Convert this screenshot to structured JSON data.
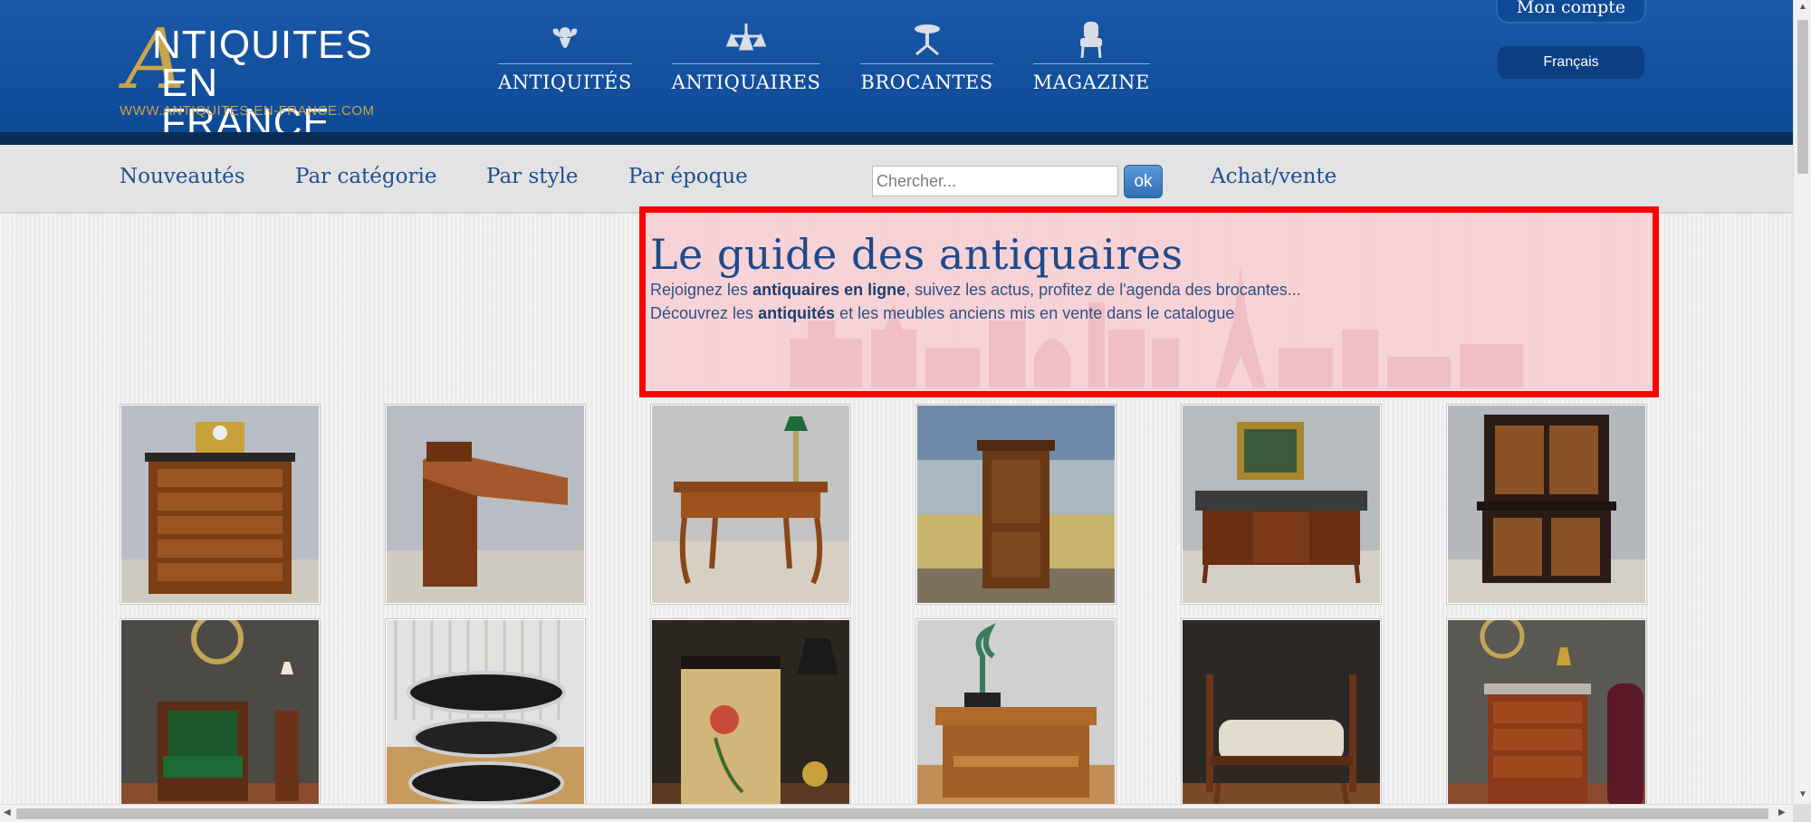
{
  "logo": {
    "line1": "NTIQUITES",
    "line2": "EN FRANCE",
    "initial": "A",
    "url": "WWW.ANTIQUITES-EN-FRANCE.COM"
  },
  "topnav": [
    {
      "label": "ANTIQUITÉS",
      "icon": "cherub-icon"
    },
    {
      "label": "ANTIQUAIRES",
      "icon": "chandelier-icon"
    },
    {
      "label": "BROCANTES",
      "icon": "pedestal-table-icon"
    },
    {
      "label": "MAGAZINE",
      "icon": "armchair-icon"
    }
  ],
  "account": {
    "label": "Mon compte"
  },
  "language": {
    "label": "Français"
  },
  "subnav": {
    "new": "Nouveautés",
    "category": "Par catégorie",
    "style": "Par style",
    "era": "Par époque",
    "buysell": "Achat/vente"
  },
  "search": {
    "placeholder": "Chercher...",
    "button": "ok"
  },
  "hero": {
    "title": "Le guide des antiquaires",
    "line1_pre": "Rejoignez les ",
    "line1_bold": "antiquaires en ligne",
    "line1_post": ", suivez les actus, profitez de l'agenda des brocantes...",
    "line2_pre": "Découvrez les ",
    "line2_bold": "antiquités",
    "line2_post": " et les meubles anciens mis en vente dans le catalogue"
  },
  "products": [
    {
      "name": "commode-with-clock"
    },
    {
      "name": "art-deco-desk"
    },
    {
      "name": "louis-xv-writing-desk"
    },
    {
      "name": "cupboard-landscape"
    },
    {
      "name": "marble-sideboard"
    },
    {
      "name": "inlaid-cabinet"
    },
    {
      "name": "green-armchair"
    },
    {
      "name": "round-chrome-table"
    },
    {
      "name": "painted-cabinet"
    },
    {
      "name": "serving-table"
    },
    {
      "name": "bench"
    },
    {
      "name": "chest-of-drawers"
    }
  ],
  "colors": {
    "header": "#0e4a96",
    "nav_link": "#1d4f93",
    "gold": "#c9a44a",
    "hero_bg": "#f8cdd2",
    "highlight": "#ff0000"
  }
}
